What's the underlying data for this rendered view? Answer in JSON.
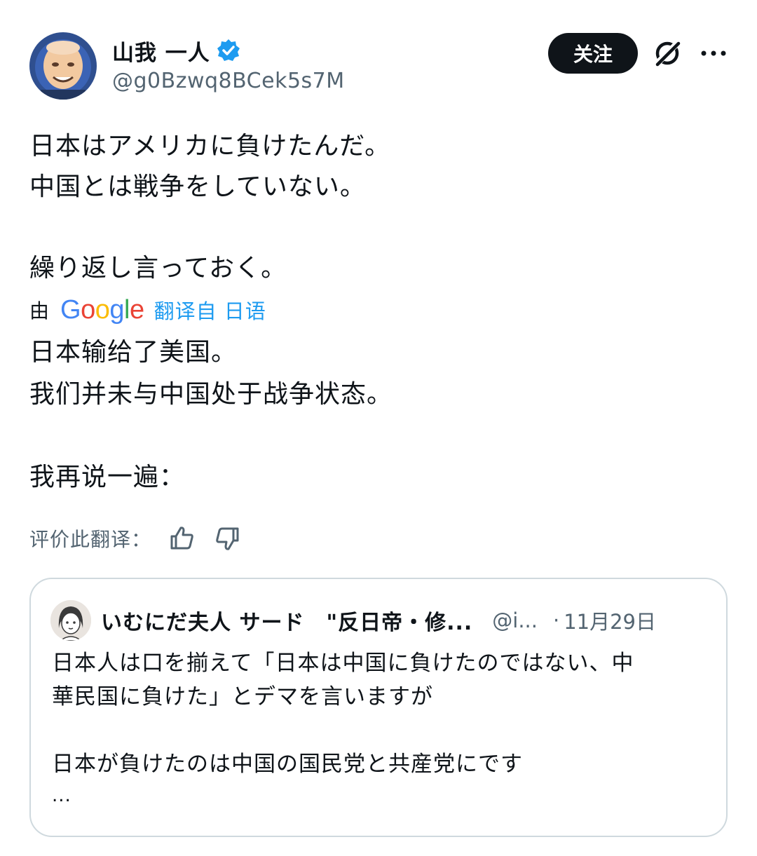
{
  "author": {
    "display_name": "山我 一人",
    "handle": "@g0Bzwq8BCek5s7M",
    "verified_icon": "verified-badge-icon",
    "avatar_icon": "avatar-image"
  },
  "actions": {
    "follow_label": "关注",
    "grok_icon": "grok-icon",
    "more_icon": "more-options-icon"
  },
  "tweet": {
    "original_lines": [
      "日本はアメリカに負けたんだ。",
      "中国とは戦争をしていない。",
      "繰り返し言っておく。"
    ],
    "translated_by_prefix": "由",
    "translator_logo": [
      "G",
      "o",
      "o",
      "g",
      "l",
      "e"
    ],
    "translate_link": "翻译自 日语",
    "translated_lines": [
      "日本输给了美国。",
      "我们并未与中国处于战争状态。",
      "我再说一遍："
    ],
    "rate_label": "评价此翻译：",
    "thumbs_up_icon": "thumbs-up-icon",
    "thumbs_down_icon": "thumbs-down-icon"
  },
  "quote": {
    "display_name": "いむにだ夫人 サード　\"反日帝・修...",
    "handle": "@i...",
    "separator": "·",
    "date": "11月29日",
    "lines": [
      "日本人は口を揃えて「日本は中国に負けたのではない、中",
      "華民国に負けた」とデマを言いますが",
      "日本が負けたのは中国の国民党と共産党にです",
      "..."
    ]
  },
  "colors": {
    "text": "#0f1419",
    "secondary": "#536471",
    "link": "#1d9bf0",
    "border": "#cfd9de",
    "verified": "#1d9bf0"
  }
}
